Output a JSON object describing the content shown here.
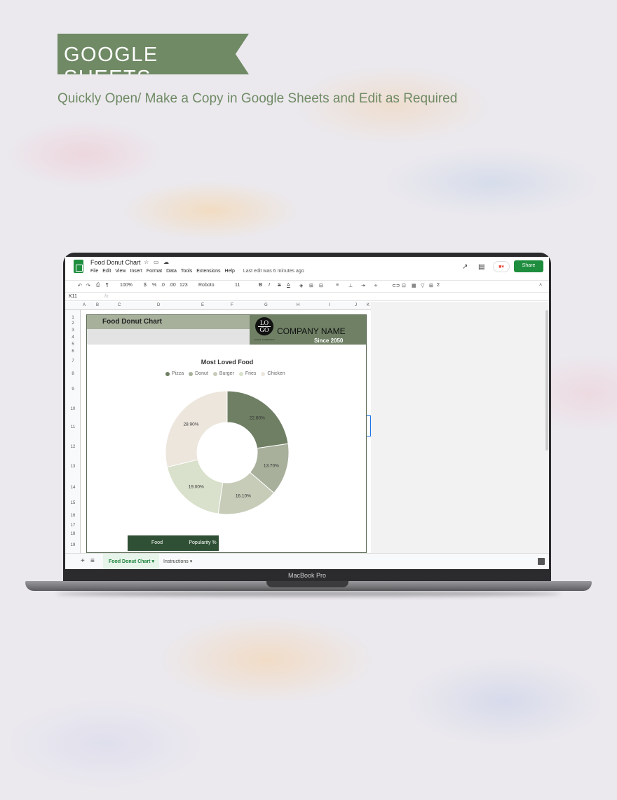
{
  "banner": {
    "title": "GOOGLE SHEETS",
    "subtitle": "Quickly Open/ Make a Copy in Google Sheets and Edit as Required"
  },
  "laptop": {
    "label": "MacBook Pro"
  },
  "sheet": {
    "doc_title": "Food Donut Chart",
    "menus": [
      "File",
      "Edit",
      "View",
      "Insert",
      "Format",
      "Data",
      "Tools",
      "Extensions",
      "Help"
    ],
    "last_edit": "Last edit was 6 minutes ago",
    "share_label": "Share",
    "toolbar": {
      "zoom": "100%",
      "currency": "$",
      "percent": "%",
      "decimals": ".0",
      "more_decimals": ".00",
      "format": "123",
      "font": "Roboto",
      "font_size": "11"
    },
    "cell_ref": "K11",
    "fx": "fx",
    "columns": [
      "A",
      "B",
      "C",
      "D",
      "E",
      "F",
      "G",
      "H",
      "I",
      "J",
      "K"
    ],
    "rows": [
      "1",
      "2",
      "3",
      "4",
      "5",
      "6",
      "7",
      "8",
      "9",
      "10",
      "11",
      "12",
      "13",
      "14",
      "15",
      "16",
      "17",
      "18",
      "19"
    ]
  },
  "report": {
    "title": "Food Donut Chart",
    "logo_top": "LO",
    "logo_bottom": "GO",
    "logo_sub": "LOGO COMPANY",
    "company_name": "COMPANY NAME",
    "since": "Since 2050",
    "table_headers": [
      "Food",
      "Popularity %"
    ]
  },
  "tabs": [
    {
      "label": "Food Donut Chart"
    },
    {
      "label": "Instructions"
    }
  ],
  "colors": {
    "accent": "#6f8a64",
    "share": "#1e8e3e",
    "dark_green": "#2f5034"
  },
  "chart_data": {
    "type": "pie",
    "title": "Most Loved Food",
    "categories": [
      "Pizza",
      "Donut",
      "Burger",
      "Fries",
      "Chicken"
    ],
    "values": [
      22.8,
      13.7,
      16.1,
      19.0,
      28.9
    ],
    "labels": [
      "22.80%",
      "13.70%",
      "16.10%",
      "19.00%",
      "28.90%"
    ],
    "colors": [
      "#6f7f64",
      "#a8b09c",
      "#c6ccb8",
      "#d9e0cb",
      "#ede6dd"
    ],
    "legend": "top",
    "donut": true
  }
}
